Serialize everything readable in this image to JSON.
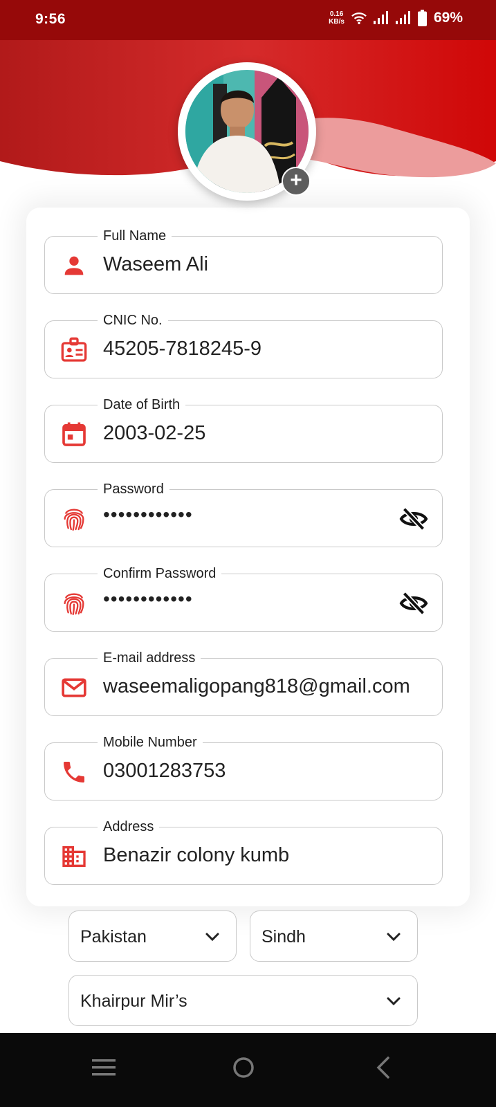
{
  "status": {
    "time": "9:56",
    "netspeed_value": "0.16",
    "netspeed_unit": "KB/s",
    "battery": "69%",
    "icons": [
      "wifi-icon",
      "signal-icon",
      "signal-icon",
      "battery-icon"
    ]
  },
  "profile": {
    "avatar_icon": "profile-photo",
    "add_photo_label": "+"
  },
  "form": {
    "fields": [
      {
        "label": "Full Name",
        "value": "Waseem Ali",
        "icon": "person-icon"
      },
      {
        "label": "CNIC No.",
        "value": "45205-7818245-9",
        "icon": "id-card-icon"
      },
      {
        "label": "Date of Birth",
        "value": "2003-02-25",
        "icon": "calendar-icon"
      },
      {
        "label": "Password",
        "value": "••••••••••••",
        "icon": "fingerprint-icon",
        "toggle_icon": "eye-off-icon"
      },
      {
        "label": "Confirm Password",
        "value": "••••••••••••",
        "icon": "fingerprint-icon",
        "toggle_icon": "eye-off-icon"
      },
      {
        "label": "E-mail address",
        "value": "waseemaligopang818@gmail.com",
        "icon": "email-icon"
      },
      {
        "label": "Mobile Number",
        "value": "03001283753",
        "icon": "phone-icon"
      },
      {
        "label": "Address",
        "value": "Benazir colony kumb",
        "icon": "building-icon"
      }
    ],
    "country": "Pakistan",
    "province": "Sindh",
    "district": "Khairpur Mir’s"
  },
  "nav": {
    "icons": [
      "menu-icon",
      "home-icon",
      "back-icon"
    ]
  },
  "colors": {
    "accent": "#e53935",
    "header_red": "#cc0d0d",
    "status_bar": "#960909"
  }
}
